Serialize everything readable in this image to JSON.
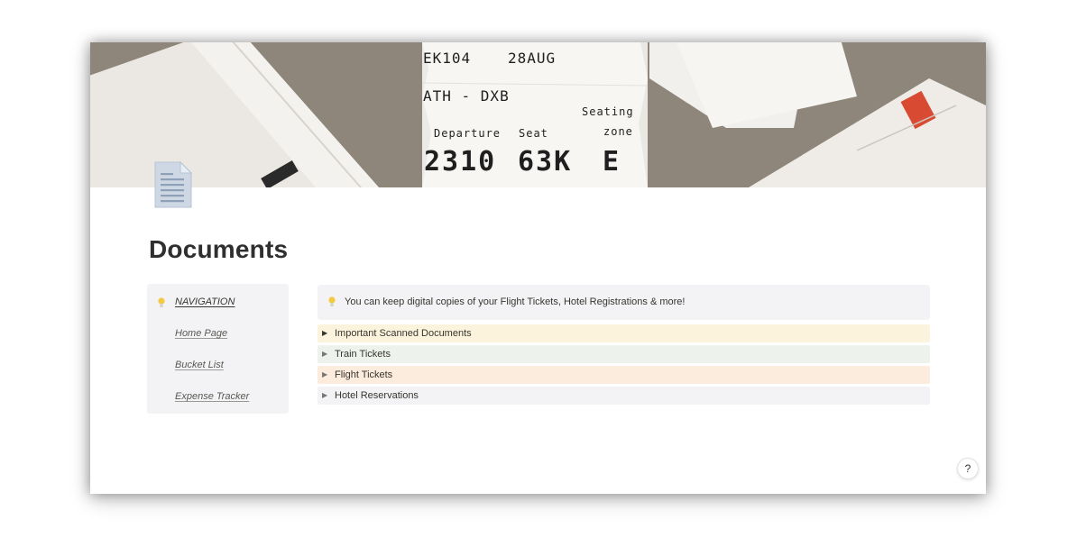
{
  "cover": {
    "ticket": {
      "flight": "EK104",
      "date": "28AUG",
      "route": "ATH - DXB",
      "seating_label": "Seating",
      "departure_label": "Departure",
      "seat_label": "Seat",
      "zone_label": "zone",
      "departure_value": "2310",
      "seat_value": "63K",
      "zone_value": "E"
    }
  },
  "page": {
    "icon": "document-icon",
    "title": "Documents"
  },
  "navigation": {
    "heading": "NAVIGATION",
    "icon": "lightbulb-icon",
    "links": [
      {
        "label": "Home Page"
      },
      {
        "label": "Bucket List"
      },
      {
        "label": "Expense Tracker"
      }
    ]
  },
  "callout": {
    "icon": "lightbulb-icon",
    "text": "You can keep digital copies of your Flight Tickets, Hotel Registrations & more!"
  },
  "toggles": [
    {
      "label": "Important Scanned Documents",
      "color": "#fbf3db",
      "arrow_color": "#37352f"
    },
    {
      "label": "Train Tickets",
      "color": "#edf3ec",
      "arrow_color": "#787774"
    },
    {
      "label": "Flight Tickets",
      "color": "#fbecdd",
      "arrow_color": "#787774"
    },
    {
      "label": "Hotel Reservations",
      "color": "#f3f3f6",
      "arrow_color": "#787774"
    }
  ],
  "help": {
    "label": "?"
  },
  "colors": {
    "callout_bg": "#f3f3f6",
    "bulb": "#f5c842"
  }
}
